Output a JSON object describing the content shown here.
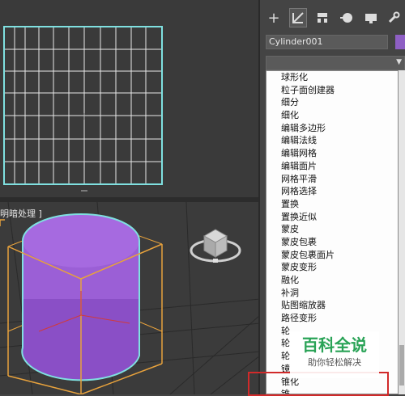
{
  "viewports": {
    "perspective_label": "明暗处理 ]"
  },
  "command_panel": {
    "tabs": [
      {
        "name": "create",
        "glyph": "+"
      },
      {
        "name": "modify",
        "glyph": "⛶"
      },
      {
        "name": "hierarchy",
        "glyph": "▦"
      },
      {
        "name": "motion",
        "glyph": "●"
      },
      {
        "name": "display",
        "glyph": "▬"
      },
      {
        "name": "utilities",
        "glyph": "🔧"
      }
    ],
    "object_name": "Cylinder001",
    "object_color": "#8e5fc4",
    "modifier_list": [
      "球形化",
      "粒子面创建器",
      "细分",
      "细化",
      "编辑多边形",
      "编辑法线",
      "编辑网格",
      "编辑面片",
      "网格平滑",
      "网格选择",
      "置换",
      "置换近似",
      "蒙皮",
      "蒙皮包裹",
      "蒙皮包裹面片",
      "蒙皮变形",
      "融化",
      "补洞",
      "贴图缩放器",
      "路径变形",
      "轮",
      "轮",
      "轮",
      "镜",
      "锥化",
      "锥"
    ],
    "highlighted_item": "锥化"
  },
  "watermark": {
    "title": "百科全说",
    "subtitle": "助你轻松解决"
  },
  "colors": {
    "cylinder": "#9b5fd6",
    "highlight": "#d12a2a",
    "bbox": "#e8a23c",
    "grid_frame": "#7fe0e0"
  }
}
